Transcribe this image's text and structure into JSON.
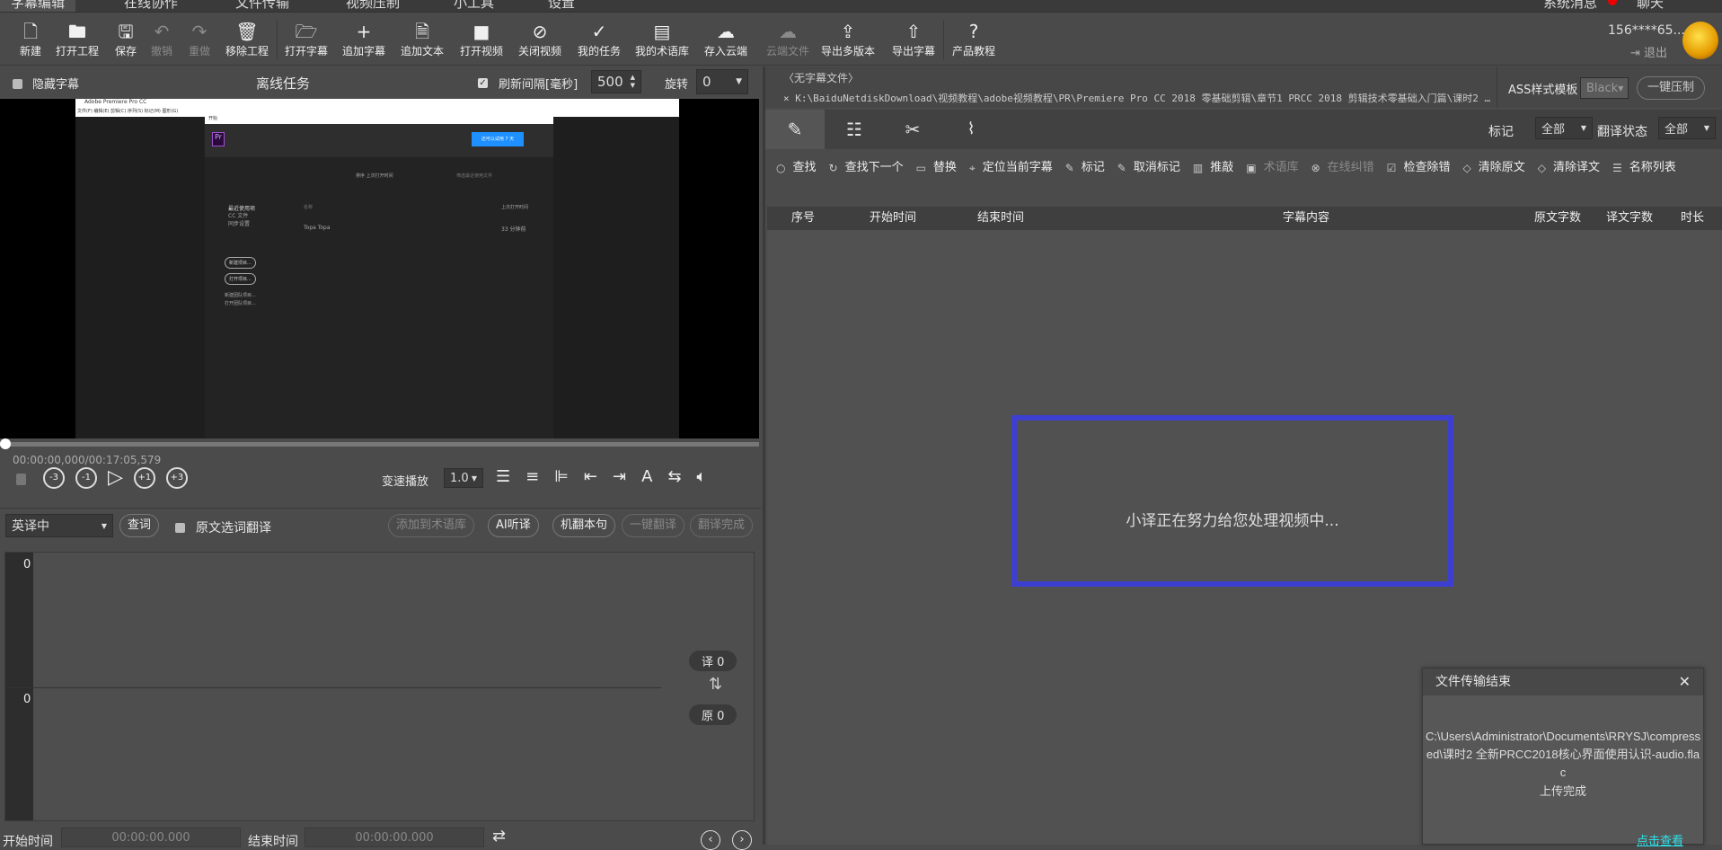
{
  "menu": {
    "tabs": [
      "字幕编辑",
      "在线协作",
      "文件传输",
      "视频压制",
      "小工具",
      "设置"
    ],
    "system_msg": "系统消息",
    "chat": "聊天"
  },
  "toolbar": [
    {
      "icon": "new-file-icon",
      "label": "新建"
    },
    {
      "icon": "folder-icon",
      "label": "打开工程"
    },
    {
      "icon": "save-icon",
      "label": "保存"
    },
    {
      "icon": "undo-icon",
      "label": "撤销",
      "disabled": true
    },
    {
      "icon": "redo-icon",
      "label": "重做",
      "disabled": true
    },
    {
      "icon": "trash-icon",
      "label": "移除工程"
    },
    {
      "icon": "folder-open-icon",
      "label": "打开字幕"
    },
    {
      "icon": "plus-icon",
      "label": "追加字幕"
    },
    {
      "icon": "document-icon",
      "label": "追加文本"
    },
    {
      "icon": "video-camera-icon",
      "label": "打开视频"
    },
    {
      "icon": "video-off-icon",
      "label": "关闭视频"
    },
    {
      "icon": "clipboard-check-icon",
      "label": "我的任务"
    },
    {
      "icon": "glossary-book-icon",
      "label": "我的术语库"
    },
    {
      "icon": "cloud-save-icon",
      "label": "存入云端"
    },
    {
      "icon": "cloud-file-icon",
      "label": "云端文件",
      "disabled": true
    },
    {
      "icon": "layers-export-icon",
      "label": "导出多版本"
    },
    {
      "icon": "file-export-icon",
      "label": "导出字幕"
    },
    {
      "icon": "help-icon",
      "label": "产品教程"
    }
  ],
  "user": {
    "name": "156****65...",
    "logout": "退出"
  },
  "left": {
    "hide_subs": "隐藏字幕",
    "offline_task": "离线任务",
    "refresh_label": "刷新间隔[毫秒]",
    "refresh_value": "500",
    "rotate_label": "旋转",
    "rotate_value": "0",
    "video": {
      "app_title": "Adobe Premiere Pro CC",
      "menus": "文件(F)  编辑(E)  剪辑(C)  序列(S)  标记(M)  图形(G)",
      "dialog_title": "开始",
      "trial": "还可以试用 7 天",
      "sort": "排序  上次打开时间",
      "search_ph": "筛选最近使用文件",
      "nav": [
        "最近使用项",
        "CC 文件",
        "同步设置"
      ],
      "col_name": "名称",
      "col_time": "上次打开时间",
      "row_name": "Topa Topa",
      "row_time": "33 分钟前",
      "btn_new": "新建项目...",
      "btn_open": "打开项目...",
      "team_new": "新建团队项目...",
      "team_open": "打开团队项目..."
    },
    "timecode": "00:00:00,000/00:17:05,579",
    "playback": [
      "-3",
      "-1",
      "play",
      "+1",
      "+3"
    ],
    "speed_label": "变速播放",
    "speed_value": "1.0",
    "lang": "英译中",
    "lookup": "查词",
    "select_translate": "原文选词翻译",
    "actions": [
      {
        "label": "添加到术语库",
        "disabled": true
      },
      {
        "label": "AI听译"
      },
      {
        "label": "机翻本句"
      },
      {
        "label": "一键翻译",
        "disabled": true
      },
      {
        "label": "翻译完成",
        "disabled": true
      }
    ],
    "editor": {
      "top_count": "0",
      "bottom_count": "0",
      "trans_badge": "译 0",
      "orig_badge": "原 0"
    },
    "start_label": "开始时间",
    "start_value": "00:00:00.000",
    "end_label": "结束时间",
    "end_value": "00:00:00.000"
  },
  "right": {
    "no_sub_file": "〈无字幕文件〉",
    "path": "K:\\BaiduNetdiskDownload\\视频教程\\adobe视频教程\\PR\\Premiere Pro CC 2018 零基础剪辑\\章节1 PRCC 2018 剪辑技术零基础入门篇\\课时2 …",
    "ass_label": "ASS样式模板",
    "ass_value": "Black",
    "burn": "一键压制",
    "mark_label": "标记",
    "mark_value": "全部",
    "status_label": "翻译状态",
    "status_value": "全部",
    "tools": [
      {
        "icon": "search-icon",
        "label": "查找"
      },
      {
        "icon": "search-next-icon",
        "label": "查找下一个"
      },
      {
        "icon": "replace-icon",
        "label": "替换"
      },
      {
        "icon": "location-pin-icon",
        "label": "定位当前字幕"
      },
      {
        "icon": "pin-icon",
        "label": "标记"
      },
      {
        "icon": "unpin-icon",
        "label": "取消标记"
      },
      {
        "icon": "polish-icon",
        "label": "推敲"
      },
      {
        "icon": "glossary-icon",
        "label": "术语库",
        "disabled": true
      },
      {
        "icon": "online-check-icon",
        "label": "在线纠错",
        "disabled": true
      },
      {
        "icon": "checkbox-icon",
        "label": "检查除错"
      },
      {
        "icon": "eraser-icon",
        "label": "清除原文"
      },
      {
        "icon": "eraser-icon",
        "label": "清除译文"
      },
      {
        "icon": "list-icon",
        "label": "名称列表"
      }
    ],
    "columns": [
      "序号",
      "开始时间",
      "结束时间",
      "字幕内容",
      "原文字数",
      "译文字数",
      "时长"
    ],
    "processing": "小译正在努力给您处理视频中...",
    "processing_border": "#3d3fd0",
    "toast": {
      "title": "文件传输结束",
      "message": "C:\\Users\\Administrator\\Documents\\RRYSJ\\compressed\\课时2 全新PRCC2018核心界面使用认识-audio.flac",
      "status": "上传完成",
      "link": "点击查看",
      "link_color": "#2fe0e8"
    }
  }
}
